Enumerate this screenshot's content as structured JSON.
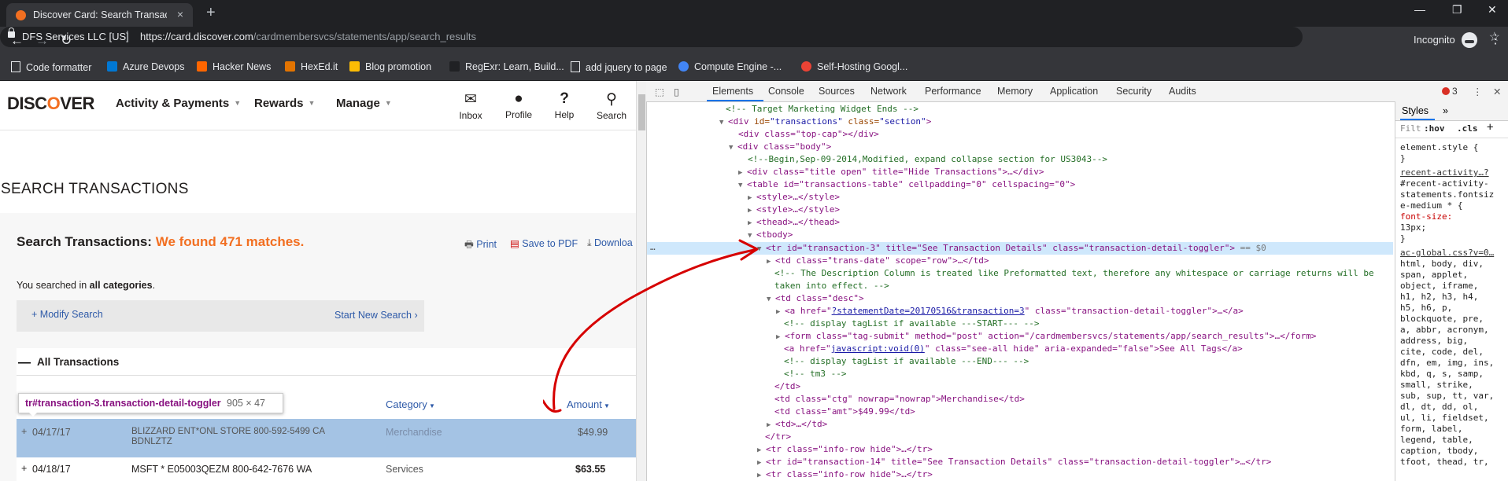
{
  "browser": {
    "tab_title": "Discover Card: Search Transactio",
    "tab_close": "×",
    "new_tab": "+",
    "win_min": "—",
    "win_restore": "❐",
    "win_close": "✕",
    "back": "←",
    "forward": "→",
    "reload": "↻",
    "site_org": "DFS Services LLC [US]",
    "separator": "|",
    "url_host": "https://card.discover.com",
    "url_path": "/cardmembersvcs/statements/app/search_results",
    "star": "☆",
    "incognito_label": "Incognito",
    "menu": "⋮",
    "bookmarks": [
      {
        "label": "Code formatter",
        "color": "#e8eaed"
      },
      {
        "label": "Azure Devops",
        "color": "#0078d4"
      },
      {
        "label": "Hacker News",
        "color": "#ff6600"
      },
      {
        "label": "HexEd.it",
        "color": "#e37400"
      },
      {
        "label": "Blog promotion",
        "color": "#fbbc04"
      },
      {
        "label": "RegExr: Learn, Build...",
        "color": "#35363a"
      },
      {
        "label": "add jquery to page",
        "color": "#e8eaed"
      },
      {
        "label": "Compute Engine -...",
        "color": "#4285f4"
      },
      {
        "label": "Self-Hosting Googl...",
        "color": "#ea4335"
      }
    ]
  },
  "discover": {
    "logo_pre": "DISC",
    "logo_o": "O",
    "logo_post": "VER",
    "nav": [
      "Activity & Payments",
      "Rewards",
      "Manage"
    ],
    "caret": "▼",
    "icons": [
      {
        "label": "Inbox",
        "glyph": "✉"
      },
      {
        "label": "Profile",
        "glyph": "●"
      },
      {
        "label": "Help",
        "glyph": "?"
      },
      {
        "label": "Search",
        "glyph": "⚲"
      }
    ],
    "page_title": "SEARCH TRANSACTIONS",
    "search_heading": "Search Transactions:",
    "matches": "We found 471 matches.",
    "print": "Print",
    "save_pdf": "Save to PDF",
    "download": "Downloa",
    "searched_pre": "You searched in ",
    "searched_bold": "all categories",
    "searched_post": ".",
    "modify": "Modify Search",
    "start_new": "Start New Search",
    "all_tx": "All Transactions",
    "col_category": "Category",
    "col_amount": "Amount",
    "tooltip_selector": "tr#transaction-3.transaction-detail-toggler",
    "tooltip_size": "905 × 47",
    "rows": [
      {
        "date": "04/17/17",
        "desc1": "BLIZZARD ENT*ONL STORE 800-592-5499 CA",
        "desc2": "BDNLZTZ",
        "category": "Merchandise",
        "amount": "$49.99"
      },
      {
        "date": "04/18/17",
        "desc1": "MSFT * E05003QEZM 800-642-7676 WA",
        "desc2": "",
        "category": "Services",
        "amount": "$63.55"
      }
    ]
  },
  "devtools": {
    "tabs": [
      "Elements",
      "Console",
      "Sources",
      "Network",
      "Performance",
      "Memory",
      "Application",
      "Security",
      "Audits"
    ],
    "error_count": "3",
    "styles_tab": "Styles",
    "styles_more": "»",
    "filter": "Filt",
    "hov": ":hov",
    "cls": ".cls",
    "plus": "+",
    "styles_lines": [
      "element.style {",
      "}",
      "recent-activity…?",
      "#recent-activity-",
      "statements.fontsiz",
      "e-medium * {",
      "  font-size:",
      "    13px;",
      "}",
      "ac-global.css?v=0…",
      "html, body, div,",
      "span, applet,",
      "object, iframe,",
      "h1, h2, h3, h4,",
      "h5, h6, p,",
      "blockquote, pre,",
      "a, abbr, acronym,",
      "address, big,",
      "cite, code, del,",
      "dfn, em, img, ins,",
      "kbd, q, s, samp,",
      "small, strike,",
      "sub, sup, tt, var,",
      "dl, dt, dd, ol,",
      "ul, li, fieldset,",
      "form, label,",
      "legend, table,",
      "caption, tbody,",
      "tfoot, thead, tr,"
    ],
    "dom": {
      "l0": "<!-- Target Marketing Widget Ends -->",
      "l1_tag": "<div",
      "l1_a1": " id=",
      "l1_v1": "\"transactions\"",
      "l1_a2": " class=",
      "l1_v2": "\"section\"",
      "l1_end": ">",
      "l2": "<div class=\"top-cap\"></div>",
      "l3": "<div class=\"body\">",
      "l4": "<!--Begin,Sep-09-2014,Modified, expand collapse section for US3043-->",
      "l5": "<div class=\"title open\" title=\"Hide Transactions\">…</div>",
      "l6": "<table id=\"transactions-table\" cellpadding=\"0\" cellspacing=\"0\">",
      "l7": "<style>…</style>",
      "l8": "<style>…</style>",
      "l9": "<thead>…</thead>",
      "l10": "<tbody>",
      "l11": "<tr id=\"transaction-3\" title=\"See Transaction Details\" class=\"transaction-detail-toggler\">",
      "l11_sel": " == $0",
      "l12": "<td class=\"trans-date\" scope=\"row\">…</td>",
      "l13a": "<!-- The Description Column is treated like Preformatted text, therefore any whitespace or carriage returns will be",
      "l13b": "taken into effect.  -->",
      "l14": "<td class=\"desc\">",
      "l15_pre": "<a href=\"",
      "l15_link": "?statementDate=20170516&transaction=3",
      "l15_post": "\" class=\"transaction-detail-toggler\">…</a>",
      "l16": "<!-- display tagList if available ---START--- -->",
      "l17": "<form class=\"tag-submit\" method=\"post\" action=\"/cardmembersvcs/statements/app/search_results\">…</form>",
      "l18_pre": "<a href=\"",
      "l18_link": "javascript:void(0)",
      "l18_post": "\" class=\"see-all hide\" aria-expanded=\"false\">See All Tags</a>",
      "l19": "<!-- display tagList if available ---END--- -->",
      "l20": "<!-- tm3 -->",
      "l21": "</td>",
      "l22": "<td class=\"ctg\" nowrap=\"nowrap\">Merchandise</td>",
      "l23": "<td class=\"amt\">$49.99</td>",
      "l24": "<td>…</td>",
      "l25": "</tr>",
      "l26": "<tr class=\"info-row hide\">…</tr>",
      "l27": "<tr id=\"transaction-14\" title=\"See Transaction Details\" class=\"transaction-detail-toggler\">…</tr>",
      "l28": "<tr class=\"info-row hide\">…</tr>",
      "dots": "…"
    }
  },
  "colors": {
    "accent": "#f26f21",
    "link": "#2e5aa8",
    "selected_row": "#a4c3e4",
    "annotation": "#d60000"
  }
}
